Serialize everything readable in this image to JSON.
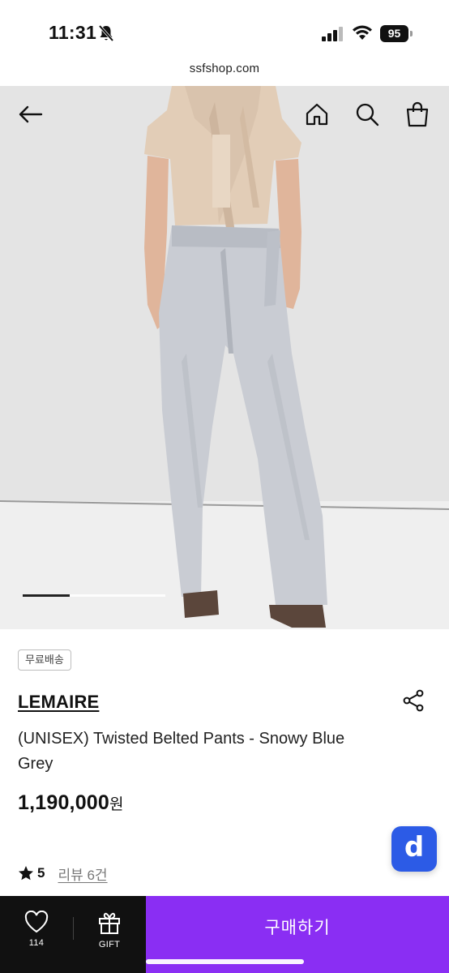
{
  "status_bar": {
    "time": "11:31",
    "battery": "95"
  },
  "browser": {
    "url": "ssfshop.com"
  },
  "hero": {
    "image_description_icon": "product-photo",
    "carousel_progress": 0.33
  },
  "product": {
    "badge": "무료배송",
    "brand": "LEMAIRE",
    "title": "(UNISEX) Twisted Belted Pants - Snowy Blue Grey",
    "price": "1,190,000",
    "price_unit": "원",
    "rating": "5",
    "review_label": "리뷰 6건"
  },
  "fab": {
    "label": "d",
    "color": "#2c5be6"
  },
  "bottom_bar": {
    "like_count": "114",
    "gift_label": "GIFT",
    "buy_label": "구매하기",
    "buy_color": "#8a2ef3"
  }
}
